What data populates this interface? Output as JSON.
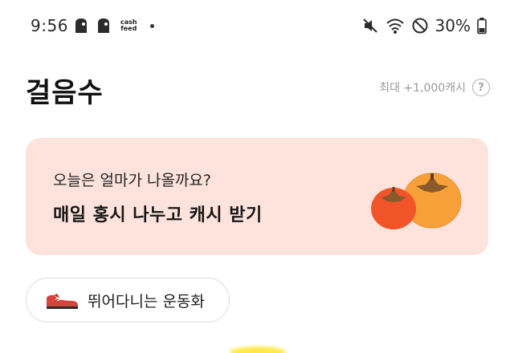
{
  "status_bar": {
    "time": "9:56",
    "app_icons": [
      "app-ghost-icon",
      "app-ghost-icon"
    ],
    "cashfeed_line1": "cash",
    "cashfeed_line2": "feed",
    "battery_percent": "30%"
  },
  "header": {
    "title": "걸음수",
    "max_cash": "최대 +1,000캐시",
    "help_symbol": "?"
  },
  "banner": {
    "subtitle": "오늘은 얼마가 나올까요?",
    "main": "매일 홍시 나누고 캐시 받기",
    "background": "#fde3dc"
  },
  "chip": {
    "label": "뛰어다니는 운동화"
  }
}
